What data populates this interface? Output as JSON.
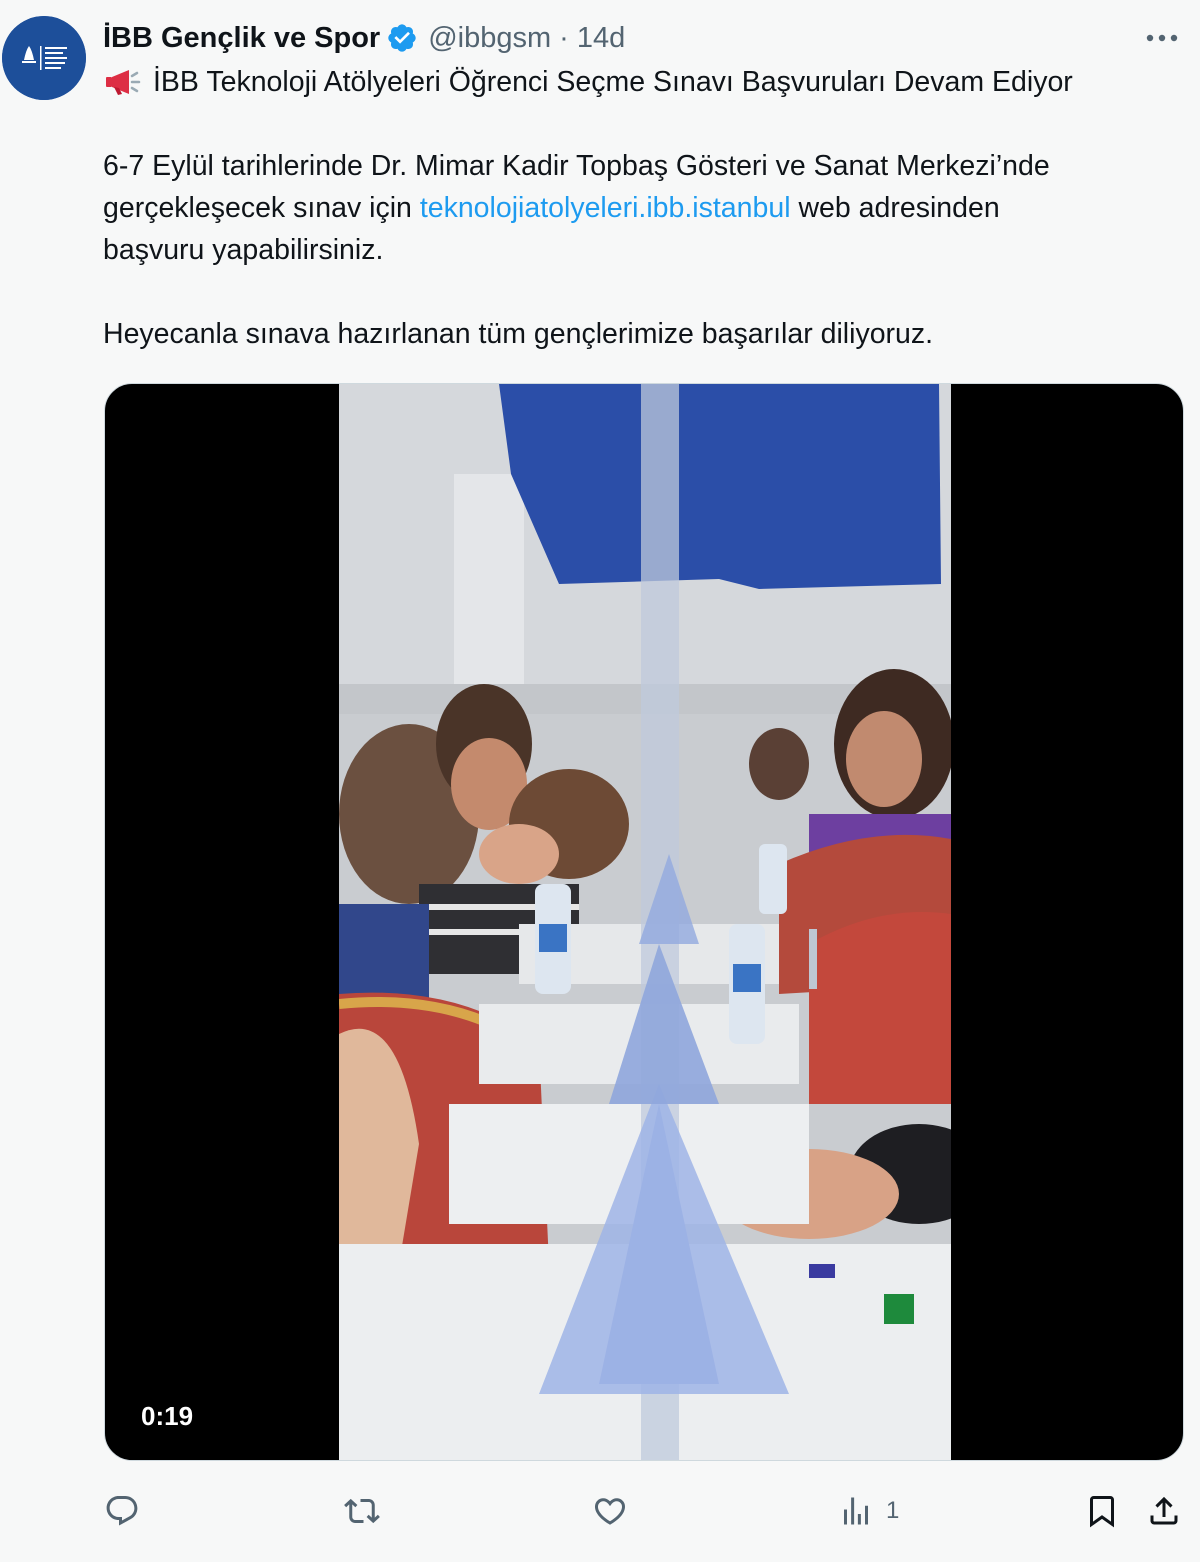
{
  "tweet": {
    "display_name": "İBB Gençlik ve Spor",
    "handle": "@ibbgsm",
    "separator": "·",
    "time": "14d",
    "headline": "İBB Teknoloji Atölyeleri Öğrenci Seçme Sınavı Başvuruları Devam Ediyor",
    "body_line1": "6-7 Eylül tarihlerinde Dr. Mimar Kadir Topbaş Gösteri ve Sanat Merkezi’nde",
    "body_line2_before": "gerçekleşecek sınav için ",
    "link_text": "teknolojiatolyeleri.ibb.istanbul",
    "body_line2_after": " web adresinden",
    "body_line3": "başvuru yapabilirsiniz.",
    "closing": "Heyecanla sınava hazırlanan tüm gençlerimize başarılar diliyoruz."
  },
  "video": {
    "duration": "0:19"
  },
  "actions": {
    "views_count": "1"
  },
  "icons": {
    "avatar": "ibb-logo-icon",
    "verified": "verified-badge-icon",
    "more": "more-icon",
    "megaphone": "megaphone-icon",
    "reply": "reply-icon",
    "retweet": "retweet-icon",
    "like": "heart-icon",
    "views": "views-icon",
    "bookmark": "bookmark-icon",
    "share": "share-icon"
  },
  "colors": {
    "link": "#1d9bf0",
    "verified": "#1d9bf0",
    "secondary_text": "#536471",
    "avatar_bg": "#1d4f9a"
  }
}
